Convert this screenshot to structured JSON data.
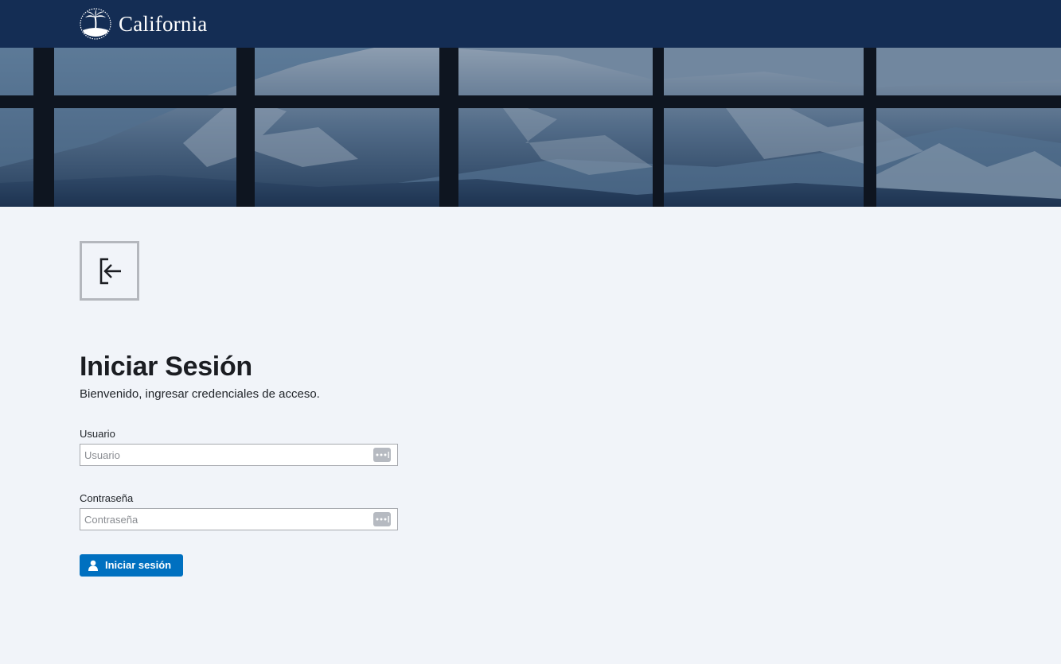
{
  "header": {
    "brand_name": "California",
    "logo_icon": "palm-tree-icon",
    "background_color": "#142d54"
  },
  "hero": {
    "image": "snowy-mountain-window-banner"
  },
  "page_icon": "sign-in-arrow-icon",
  "login": {
    "title": "Iniciar Sesión",
    "subtitle": "Bienvenido, ingresar credenciales de acceso.",
    "username": {
      "label": "Usuario",
      "placeholder": "Usuario",
      "value": ""
    },
    "password": {
      "label": "Contraseña",
      "placeholder": "Contraseña",
      "value": ""
    },
    "submit": {
      "label": "Iniciar sesión",
      "icon": "user-icon",
      "color": "#0070c0"
    }
  }
}
